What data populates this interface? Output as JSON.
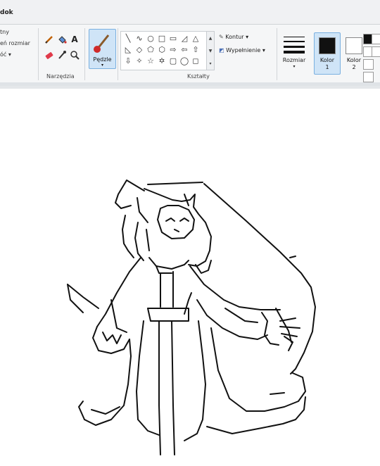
{
  "header": {
    "tab_label": "dok"
  },
  "image_group": {
    "items": [
      "tny",
      "eń rozmiar",
      "óć ▾"
    ]
  },
  "tools": {
    "group_label": "Narzędzia",
    "text_tool": "A"
  },
  "brushes": {
    "label": "Pędzle",
    "arrow": "▾"
  },
  "shapes": {
    "group_label": "Kształty",
    "glyphs": [
      "╲",
      "∿",
      "○",
      "□",
      "▭",
      "◿",
      "△",
      "◺",
      "◇",
      "⬠",
      "⬡",
      "⇨",
      "⇦",
      "⇧",
      "⇩",
      "✧",
      "☆",
      "✡",
      "▢",
      "◯",
      "◻"
    ],
    "outline_label": "Kontur ▾",
    "fill_label": "Wypełnienie ▾"
  },
  "size": {
    "label": "Rozmiar",
    "arrow": "▾"
  },
  "colors": {
    "color1_label": "Kolor",
    "color1_num": "1",
    "color1_value": "#111111",
    "color2_label": "Kolor",
    "color2_num": "2",
    "color2_value": "#ffffff",
    "palette": [
      "#111111",
      "#ffffff",
      "#ffffff",
      "#ffffff",
      "#ffffff",
      "#ffffff"
    ]
  }
}
